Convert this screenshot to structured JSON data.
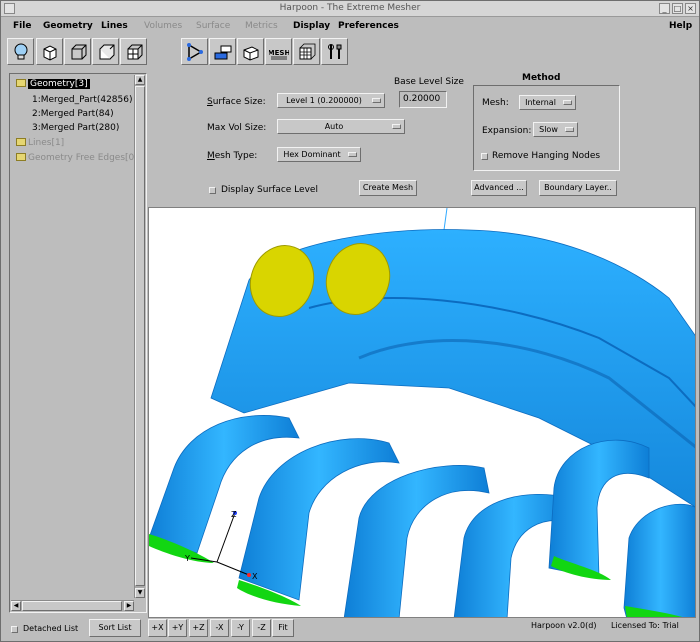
{
  "window": {
    "title": "Harpoon - The Extreme Mesher"
  },
  "menu": [
    {
      "label": "File",
      "enabled": true
    },
    {
      "label": "Geometry",
      "enabled": true
    },
    {
      "label": "Lines",
      "enabled": true
    },
    {
      "label": "Volumes",
      "enabled": false
    },
    {
      "label": "Surface",
      "enabled": false
    },
    {
      "label": "Metrics",
      "enabled": false
    },
    {
      "label": "Display",
      "enabled": true
    },
    {
      "label": "Preferences",
      "enabled": true
    },
    {
      "label": "Help",
      "enabled": true
    }
  ],
  "toolbar_icons": [
    "lightbulb-icon",
    "cube-solid-icon",
    "cube-wire-icon",
    "cube-face-icon",
    "cube-grid-icon",
    "triangle-nodes-icon",
    "blocks-icon",
    "cube-tilted-icon",
    "mesh-icon",
    "mesh-cube-icon",
    "tools-icon"
  ],
  "toolbar_mesh_text": "MESH",
  "tree": {
    "root": "Geometry[3]",
    "children": [
      "1:Merged_Part(42856)",
      "2:Merged Part(84)",
      "3:Merged Part(280)"
    ],
    "lines": "Lines[1]",
    "free_edges": "Geometry Free Edges[0]"
  },
  "form": {
    "base_level_size_label": "Base Level Size",
    "base_level_size_value": "0.20000",
    "surface_size_label_u": "S",
    "surface_size_label_rest": "urface  Size:",
    "surface_size_value": "Level 1 (0.200000)",
    "max_vol_size_label": "Max Vol  Size:",
    "max_vol_size_value": "Auto",
    "mesh_type_label_u": "M",
    "mesh_type_label_rest": "esh Type:",
    "mesh_type_value": "Hex Dominant",
    "display_surface_level": "Display Surface Level",
    "create_mesh": "Create Mesh",
    "advanced": "Advanced ...",
    "boundary_layer": "Boundary Layer.."
  },
  "method": {
    "title": "Method",
    "mesh_label": "Mesh:",
    "mesh_value": "Internal",
    "expansion_label": "Expansion:",
    "expansion_value": "Slow",
    "remove_hanging_nodes": "Remove Hanging Nodes"
  },
  "viewport": {
    "axis_labels": {
      "x": "X",
      "y": "Y",
      "z": "Z"
    },
    "colors": {
      "model": "#1ea0f0",
      "inlet": "#d9d500",
      "outlet": "#12d612",
      "background": "#ffffff"
    }
  },
  "bottom": {
    "detached_list": "Detached List",
    "sort_list": "Sort List",
    "axis_buttons": [
      "+X",
      "+Y",
      "+Z",
      "-X",
      "-Y",
      "-Z",
      "Fit"
    ],
    "version": "Harpoon v2.0(d)",
    "license": "Licensed To: Trial"
  }
}
